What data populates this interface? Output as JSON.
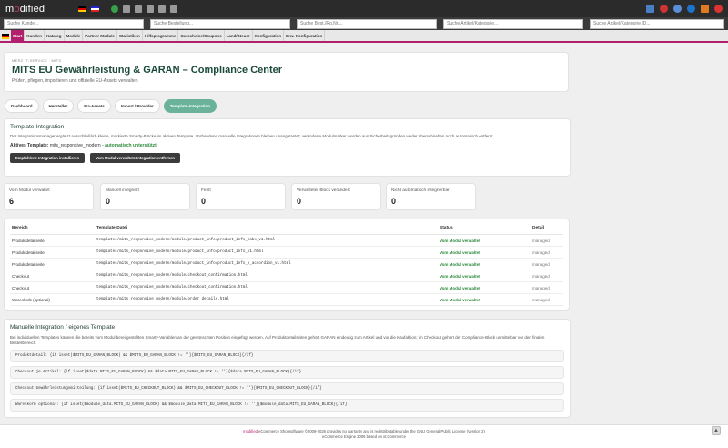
{
  "topbar": {
    "logo_pre": "m",
    "logo_o": "o",
    "logo_post": "dified"
  },
  "search": {
    "customers": "Suche Kunde...",
    "orders": "Suche Bestellung...",
    "invoice": "Suche Best./Rg.Nr....",
    "products": "Suche Artikel/Kategorie...",
    "products_id": "Suche Artikel/Kategorie ID..."
  },
  "menu": [
    "Start",
    "Kunden",
    "Katalog",
    "Module",
    "Partner Module",
    "Statistiken",
    "Hilfsprogramme",
    "Gutscheine/Coupons",
    "Land/Steuer",
    "Konfiguration",
    "Erw. Konfiguration"
  ],
  "header": {
    "eyebrow": "MERZ IT-SERVICE · MITS",
    "title": "MITS EU Gewährleistung & GARAN – Compliance Center",
    "subtitle": "Prüfen, pflegen, importieren und offizielle EU-Assets verwalten"
  },
  "tabs": [
    "Dashboard",
    "Hersteller",
    "EU-Assets",
    "Import / Provider",
    "Template-Integration"
  ],
  "integration": {
    "title": "Template-Integration",
    "desc": "Der Integrationsmanager ergänzt ausschließlich kleine, markierte Smarty-Blöcke im aktiven Template. Vorhandene manuelle Integrationen bleiben unangetastet; veränderte Modulmarker werden aus Sicherheitsgründen weder überschrieben noch automatisch entfernt.",
    "active_label": "Aktives Template:",
    "active_value": "mits_responsive_modern",
    "supported": "automatisch unterstützt",
    "btn_install": "Empfohlene Integration installieren",
    "btn_remove": "Vom Modul verwaltete Integration entfernen"
  },
  "stats": [
    {
      "label": "Vom Modul verwaltet",
      "value": "6"
    },
    {
      "label": "Manuell integriert",
      "value": "0"
    },
    {
      "label": "Fehlt",
      "value": "0"
    },
    {
      "label": "Verwalteter Block verändert",
      "value": "0"
    },
    {
      "label": "Nicht automatisch integrierbar",
      "value": "0"
    }
  ],
  "table": {
    "headers": [
      "Bereich",
      "Template-Datei",
      "Status",
      "Detail"
    ],
    "rows": [
      [
        "Produktdetailseite",
        "templates/mits_responsive_modern/module/product_info/product_info_tabs_v1.html",
        "Vom Modul verwaltet",
        "managed"
      ],
      [
        "Produktdetailseite",
        "templates/mits_responsive_modern/module/product_info/product_info_v1.html",
        "Vom Modul verwaltet",
        "managed"
      ],
      [
        "Produktdetailseite",
        "templates/mits_responsive_modern/module/product_info/product_info_x_accordion_v1.html",
        "Vom Modul verwaltet",
        "managed"
      ],
      [
        "Checkout",
        "templates/mits_responsive_modern/module/checkout_confirmation.html",
        "Vom Modul verwaltet",
        "managed"
      ],
      [
        "Checkout",
        "templates/mits_responsive_modern/module/checkout_confirmation.html",
        "Vom Modul verwaltet",
        "managed"
      ],
      [
        "Warenkorb (optional)",
        "templates/mits_responsive_modern/module/order_details.html",
        "Vom Modul verwaltet",
        "managed"
      ]
    ]
  },
  "manual": {
    "title": "Manuelle Integration / eigenes Template",
    "desc": "Bei individuellen Templates können die bereits vom Modul bereitgestellten Smarty-Variablen an der gewünschten Position eingefügt werden. Auf Produktdetailseiten gehört GARAN eindeutig zum Artikel und vor die Kaufaktion; im Checkout gehört der Compliance-Block unmittelbar vor den finalen Bestellbereich.",
    "codes": [
      "Produktdetail: {if isset($MITS_EU_GARAN_BLOCK) && $MITS_EU_GARAN_BLOCK != ''}{$MITS_EU_GARAN_BLOCK}{/if}",
      "Checkout je Artikel: {if isset($data.MITS_EU_GARAN_BLOCK) && $data.MITS_EU_GARAN_BLOCK != ''}{$data.MITS_EU_GARAN_BLOCK}{/if}",
      "Checkout Gewährleistungsmitteilung: {if isset($MITS_EU_CHECKOUT_BLOCK) && $MITS_EU_CHECKOUT_BLOCK != ''}{$MITS_EU_CHECKOUT_BLOCK}{/if}",
      "Warenkorb optional: {if isset($module_data.MITS_EU_GARAN_BLOCK) && $module_data.MITS_EU_GARAN_BLOCK != ''}{$module_data.MITS_EU_GARAN_BLOCK}{/if}"
    ]
  },
  "footer": {
    "brand": "modified",
    "line1": " eCommerce Shopsoftware ©2009-2026 provides no warranty and is redistributable under the GNU General Public License (Version 2)",
    "line2": "eCommerce Engine 2006 based on xt:Commerce"
  },
  "colors": {
    "accent": "#b21f6d",
    "title": "#1b4a3c",
    "ok": "#2d8a3a",
    "tab_active": "#6ab39a"
  }
}
